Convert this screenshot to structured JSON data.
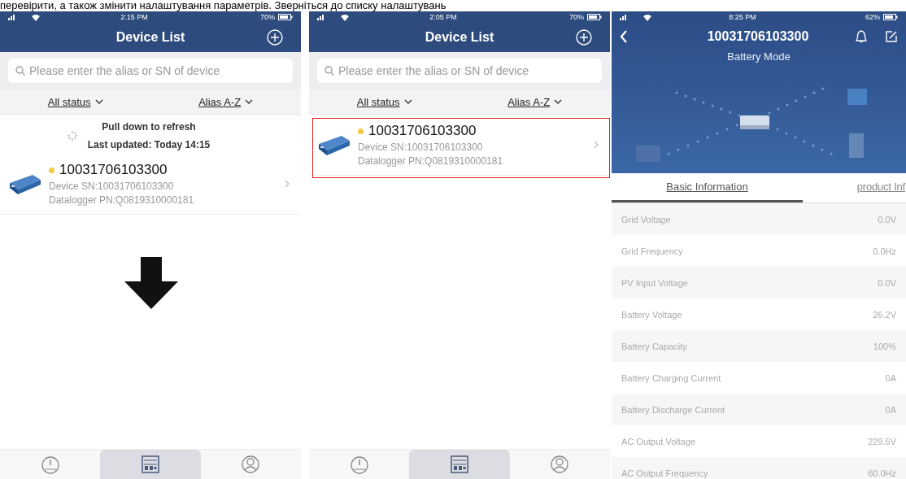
{
  "page_text": "перевірити, а також змінити налаштування параметрів. Зверніться до списку налаштувань",
  "screens": [
    {
      "kind": "device_list",
      "status_bar": {
        "time": "2:15 PM",
        "battery": "70%"
      },
      "title": "Device List",
      "search": {
        "placeholder": "Please enter the alias or SN of device"
      },
      "filters": [
        "All status",
        "Alias A-Z"
      ],
      "refresh": {
        "message": "Pull down to refresh",
        "last_updated": "Last updated: Today 14:15"
      },
      "devices": [
        {
          "name": "10031706103300",
          "color": "#f5c842",
          "sn": "Device SN:10031706103300",
          "pn": "Datalogger PN:Q0819310000181",
          "highlighted": false
        }
      ],
      "pull_arrow": true,
      "tab_bar": [
        {
          "selected": false
        },
        {
          "selected": true
        },
        {
          "selected": false
        }
      ]
    },
    {
      "kind": "device_list",
      "status_bar": {
        "time": "2:05 PM",
        "battery": "70%"
      },
      "title": "Device List",
      "search": {
        "placeholder": "Please enter the alias or SN of device"
      },
      "filters": [
        "All status",
        "Alias A-Z"
      ],
      "devices": [
        {
          "name": "10031706103300",
          "color": "#f5c842",
          "sn": "Device SN:10031706103300",
          "pn": "Datalogger PN:Q0819310000181",
          "highlighted": true
        }
      ],
      "tab_bar": [
        {
          "selected": false
        },
        {
          "selected": true
        },
        {
          "selected": false
        }
      ]
    },
    {
      "kind": "device_detail",
      "status_bar": {
        "time": "8:25 PM",
        "battery": "62%"
      },
      "title": "10031706103300",
      "mode": "Battery Mode",
      "tabs": [
        {
          "label": "Basic Information",
          "selected": true
        },
        {
          "label": "product Inf",
          "selected": false
        }
      ],
      "rows": [
        {
          "label": "Grid Voltage",
          "value": "0.0V"
        },
        {
          "label": "Grid Frequency",
          "value": "0.0Hz"
        },
        {
          "label": "PV Input Voltage",
          "value": "0.0V"
        },
        {
          "label": "Battery Voltage",
          "value": "26.2V"
        },
        {
          "label": "Battery Capacity",
          "value": "100%"
        },
        {
          "label": "Battery Charging Current",
          "value": "0A"
        },
        {
          "label": "Battery Discharge Current",
          "value": "0A"
        },
        {
          "label": "AC Output Voltage",
          "value": "229.5V"
        },
        {
          "label": "AC Output Frequency",
          "value": "60.0Hz"
        }
      ]
    }
  ]
}
